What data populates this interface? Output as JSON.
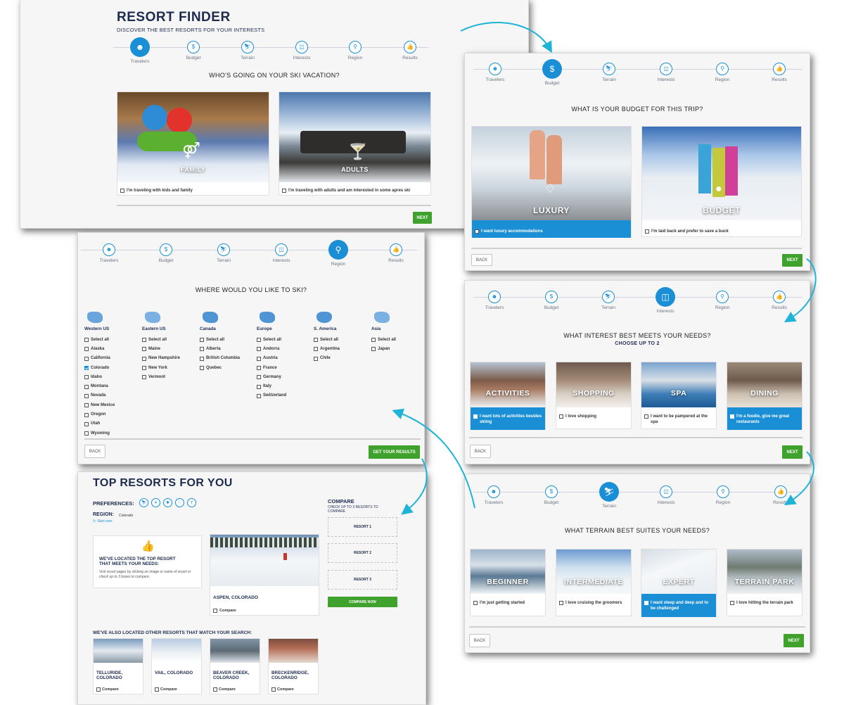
{
  "steps": [
    "Travelers",
    "Budget",
    "Terrain",
    "Interests",
    "Region",
    "Results"
  ],
  "panel1": {
    "title": "RESORT FINDER",
    "subtitle": "DISCOVER THE BEST RESORTS FOR YOUR INTERESTS",
    "question": "WHO'S GOING ON YOUR SKI VACATION?",
    "cards": [
      {
        "label": "FAMILY",
        "check": "I'm traveling with kids and family"
      },
      {
        "label": "ADULTS",
        "check": "I'm traveling with adults and am interested in some apres ski"
      }
    ],
    "next": "NEXT"
  },
  "panel2": {
    "question": "WHAT IS YOUR BUDGET FOR THIS TRIP?",
    "cards": [
      {
        "label": "LUXURY",
        "check": "I want luxury accommodations"
      },
      {
        "label": "BUDGET",
        "check": "I'm laid back and prefer to save a buck"
      }
    ],
    "back": "BACK",
    "next": "NEXT"
  },
  "panel3": {
    "question": "WHERE WOULD YOU LIKE TO SKI?",
    "regions": [
      {
        "name": "Western US",
        "items": [
          "Select all",
          "Alaska",
          "California",
          "Colorado",
          "Idaho",
          "Montana",
          "Nevada",
          "New Mexico",
          "Oregon",
          "Utah",
          "Wyoming"
        ],
        "checked": 3
      },
      {
        "name": "Eastern US",
        "items": [
          "Select all",
          "Maine",
          "New Hampshire",
          "New York",
          "Vermont"
        ],
        "checked": -1
      },
      {
        "name": "Canada",
        "items": [
          "Select all",
          "Alberta",
          "British Columbia",
          "Quebec"
        ],
        "checked": -1
      },
      {
        "name": "Europe",
        "items": [
          "Select all",
          "Andorra",
          "Austria",
          "France",
          "Germany",
          "Italy",
          "Switzerland"
        ],
        "checked": -1
      },
      {
        "name": "S. America",
        "items": [
          "Select all",
          "Argentina",
          "Chile"
        ],
        "checked": -1
      },
      {
        "name": "Asia",
        "items": [
          "Select all",
          "Japan"
        ],
        "checked": -1
      }
    ],
    "back": "BACK",
    "cta": "GET YOUR RESULTS"
  },
  "panel4": {
    "question": "WHAT INTEREST BEST MEETS YOUR NEEDS?",
    "sub": "CHOOSE UP TO 2",
    "cards": [
      {
        "label": "ACTIVITIES",
        "check": "I want lots of activities besides skiing",
        "sel": true
      },
      {
        "label": "SHOPPING",
        "check": "I love shopping",
        "sel": false
      },
      {
        "label": "SPA",
        "check": "I want to be pampered at the spa",
        "sel": false
      },
      {
        "label": "DINING",
        "check": "I'm a foodie, give me great restaurants",
        "sel": true
      }
    ],
    "back": "BACK",
    "next": "NEXT"
  },
  "panel5": {
    "question": "WHAT TERRAIN BEST SUITES YOUR NEEDS?",
    "cards": [
      {
        "label": "BEGINNER",
        "check": "I'm just getting started",
        "sel": false
      },
      {
        "label": "INTERMEDIATE",
        "check": "I love cruising the groomers",
        "sel": false
      },
      {
        "label": "EXPERT",
        "check": "I want steep and deep and to be challenged",
        "sel": true
      },
      {
        "label": "TERRAIN PARK",
        "check": "I love hitting the terrain park",
        "sel": false
      }
    ],
    "back": "BACK",
    "next": "NEXT"
  },
  "panel6": {
    "title": "TOP RESORTS FOR YOU",
    "pref_label": "PREFERENCES:",
    "region_label": "REGION:",
    "region_value": "Colorado",
    "start_over": "Start over",
    "located_title": "WE'VE LOCATED THE TOP RESORT THAT MEETS YOUR NEEDS:",
    "located_body": "Visit resort pages by clicking an image or name of resort or check up to 3 boxes to compare.",
    "top_resort": "ASPEN, COLORADO",
    "compare": "Compare",
    "compare_title": "COMPARE",
    "compare_sub": "CHECK UP TO 3 RESORTS TO COMPARE",
    "slots": [
      "RESORT 1",
      "RESORT 2",
      "RESORT 3"
    ],
    "compare_btn": "COMPARE NOW",
    "others_title": "WE'VE ALSO LOCATED OTHER RESORTS THAT MATCH YOUR SEARCH:",
    "others": [
      "TELLURIDE, COLORADO",
      "VAIL, COLORADO",
      "BEAVER CREEK, COLORADO",
      "BRECKENRIDGE, COLORADO"
    ]
  },
  "colors": {
    "accent": "#1a8fd6",
    "green": "#3fa22d",
    "navy": "#1d2b4f",
    "arrow": "#1fb3d8"
  }
}
